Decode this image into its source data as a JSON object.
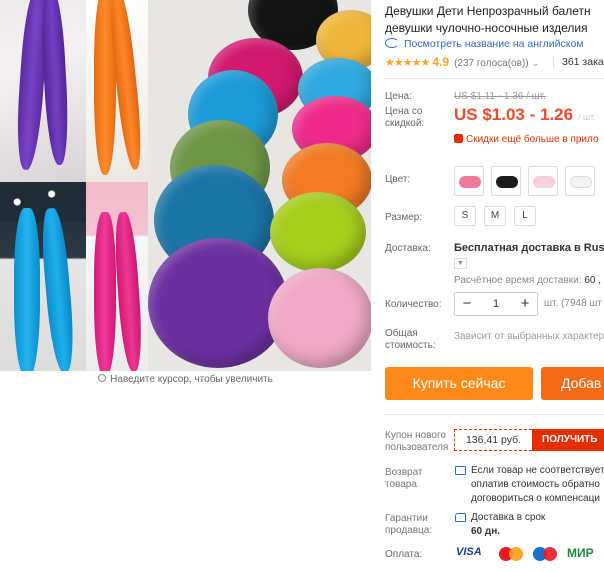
{
  "gallery": {
    "zoom_hint": "Наведите курсор, чтобы увеличить"
  },
  "product": {
    "title_line1": "Девушки Дети Непрозрачный балетн",
    "title_line2": "девушки чулочно-носочные изделия",
    "translate_link": "Посмотреть название на английском",
    "stars": "★★★★★",
    "rating": "4.9",
    "votes": "(237 голоса(ов))",
    "orders": "361 зака"
  },
  "price": {
    "label": "Цена:",
    "discount_label_1": "Цена со",
    "discount_label_2": "скидкой:",
    "old": "US $1.11 - 1.36 / шт.",
    "new": "US $1.03 - 1.26",
    "new_unit": "/ шт.",
    "note": "Скидки ещё больше в прило"
  },
  "options": {
    "color_label": "Цвет:",
    "swatches": [
      {
        "name": "pink",
        "color": "#f07a9a"
      },
      {
        "name": "black",
        "color": "#1c1c1c"
      },
      {
        "name": "light-pink",
        "color": "#f6cfdc"
      },
      {
        "name": "white",
        "color": "#f3f3f3"
      }
    ],
    "size_label": "Размер:",
    "sizes": [
      "S",
      "M",
      "L"
    ]
  },
  "shipping": {
    "label": "Доставка:",
    "title": "Бесплатная доставка в Russia",
    "eta_prefix": "Расчётное время доставки:",
    "eta_value": "60 ,"
  },
  "quantity": {
    "label": "Количество:",
    "minus": "−",
    "value": "1",
    "plus": "+",
    "note": "шт. (7948 шт"
  },
  "total": {
    "label_1": "Общая",
    "label_2": "стоимость:",
    "note": "Зависит от выбранных характер"
  },
  "actions": {
    "buy": "Купить сейчас",
    "cart": "Добав"
  },
  "coupon": {
    "label_1": "Купон нового",
    "label_2": "пользователя",
    "amount": "136,41 руб.",
    "get": "ПОЛУЧИТЬ"
  },
  "returns": {
    "label_1": "Возврат",
    "label_2": "товара",
    "line1": "Если товар не соответствует",
    "line2": "оплатив стоимость обратно",
    "line3": "договориться о компенсаци"
  },
  "guarantee": {
    "label_1": "Гарантии",
    "label_2": "продавца:",
    "line1": "Доставка в срок",
    "line2": "60 дн."
  },
  "payment": {
    "label": "Оплата:",
    "visa": "VISA",
    "mir": "МИР"
  },
  "colors": {
    "accent_orange": "#ff8a19",
    "price_red": "#f04b2a",
    "link_blue": "#2e6bc7",
    "coupon_red": "#e62e04"
  }
}
